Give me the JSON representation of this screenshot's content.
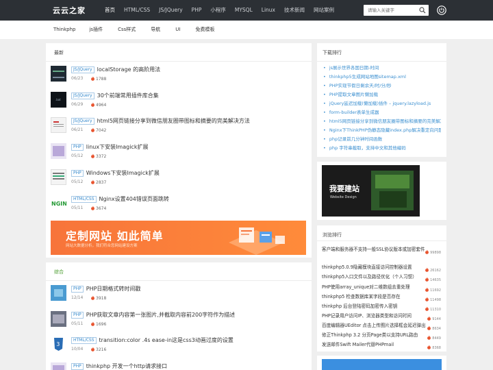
{
  "header": {
    "logo": "云云之家",
    "nav": [
      "首页",
      "HTML/CSS",
      "JS/JQuery",
      "PHP",
      "小程序",
      "MYSQL",
      "Linux",
      "技术新闻",
      "网站案例"
    ],
    "search_placeholder": "请输入关键字"
  },
  "subnav": [
    "Thinkphp",
    "js插件",
    "Css样式",
    "导航",
    "UI",
    "免费模板"
  ],
  "latest": {
    "title": "最新",
    "items": [
      {
        "tag": "JS/JQuery",
        "title": "localStorage 的高阶用法",
        "date": "06/23",
        "views": "1788"
      },
      {
        "tag": "JS/JQuery",
        "title": "30个前端常用插件库合集",
        "date": "06/29",
        "views": "4964"
      },
      {
        "tag": "JS/JQuery",
        "title": "html5网页链接分享到微信朋友圈带图标和摘要的完美解决方法",
        "date": "06/21",
        "views": "7042"
      },
      {
        "tag": "PHP",
        "title": "linux下安装Imagick扩展",
        "date": "05/12",
        "views": "3372"
      },
      {
        "tag": "PHP",
        "title": "Windows下安装Imagick扩展",
        "date": "05/12",
        "views": "2837"
      },
      {
        "tag": "HTML/CSS",
        "title": "Nginx设置404错误页面跳转",
        "date": "05/11",
        "views": "3674"
      }
    ],
    "banner_title": "定制网站 如此简单",
    "banner_sub": "网站大数据分析，我们符合您网站建设方案"
  },
  "composite": {
    "title": "综合",
    "items": [
      {
        "tag": "PHP",
        "title": "PHP日期格式转时间戳",
        "date": "12/14",
        "views": "3918"
      },
      {
        "tag": "PHP",
        "title": "PHP获取文章内容第一张图片,并截取内容前200字符作为描述",
        "date": "05/11",
        "views": "1696"
      },
      {
        "tag": "HTML/CSS",
        "title": "transition:color .4s ease-in这是css3动画过度的设置",
        "date": "10/04",
        "views": "3216"
      },
      {
        "tag": "PHP",
        "title": "thinkphp 开发一个http请求接口",
        "date": "",
        "views": ""
      }
    ]
  },
  "downloads": {
    "title": "下载排行",
    "items": [
      "js展示世界各国日期-时间",
      "thinkphp5生成网站地图sitemap.xml",
      "PHP实现节假日剩余天/时/分/秒",
      "PHP提取文章图片懒加载",
      "jQuery延迟加载(懒加载)插件 – jquery.lazyload.js",
      "form-builder表单生成器",
      "html5网页链接分享到微信朋友圈带图标和摘要的完美解决方法",
      "Nginx下ThinkPHP伪静态隐藏index.php解决重定向问题",
      "php记录前几分钟时间函数",
      "php 字符串截取，支持中文和其他编码"
    ]
  },
  "ad": {
    "title": "我要建站",
    "sub": "Website Design"
  },
  "ranking": {
    "title": "浏览排行",
    "items": [
      {
        "title": "客户端和服务器不支持一般SSL协议版本或加密套件",
        "views": "99898"
      },
      {
        "title": "thinkphp5.0.9隐藏模块直接访问控制器设置",
        "views": "26162"
      },
      {
        "title": "thinkphp5入口文件以及路径优化（个人习惯）",
        "views": "14635"
      },
      {
        "title": "PHP使用array_unique对二维数组去重处理",
        "views": "11692"
      },
      {
        "title": "thinkphp5 检查数据库某字段是否存在",
        "views": "11498"
      },
      {
        "title": "thinkphp 后台登陆密码加密传入密钥",
        "views": "11310"
      },
      {
        "title": "PHP记录用户访问IP、浏览器类型和访问时间",
        "views": "9144"
      },
      {
        "title": "百度编辑器UEditor 点击上传图片选择框会延迟弹出",
        "views": "8634"
      },
      {
        "title": "修正Thinkphp 3.2 分页Page类以支持URL路由",
        "views": "8449"
      },
      {
        "title": "发送邮件Swift Mailer代替PHPmail",
        "views": "8368"
      }
    ]
  },
  "colors": {
    "accent": "#3b8fd0",
    "nav_bg": "#2c3035",
    "flame": "#e8542f",
    "banner": "#f7743a"
  }
}
